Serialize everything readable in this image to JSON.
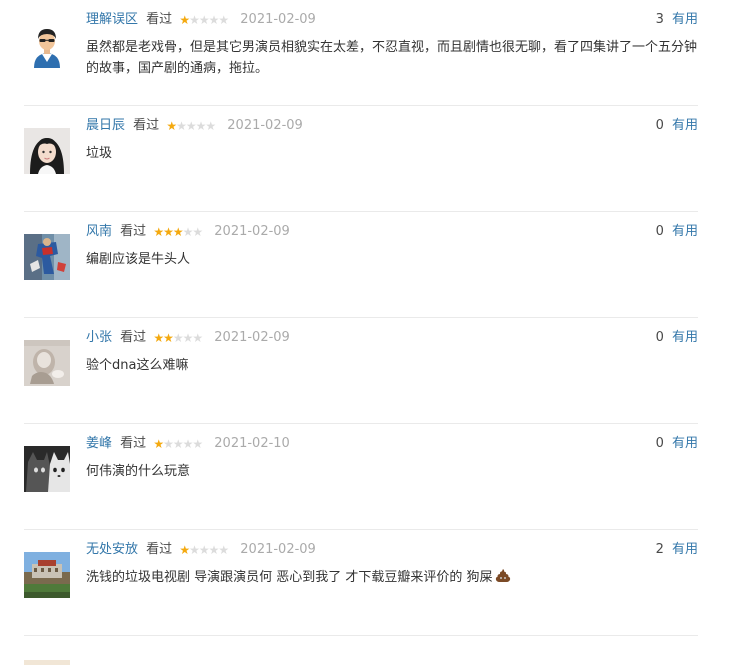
{
  "reviews": [
    {
      "user": "理解误区",
      "status": "看过",
      "stars": 1,
      "date": "2021-02-09",
      "votes": "3",
      "vote_label": "有用",
      "comment": "虽然都是老戏骨，但是其它男演员相貌实在太差，不忍直视，而且剧情也很无聊，看了四集讲了一个五分钟的故事，国产剧的通病，拖拉。"
    },
    {
      "user": "晨日辰",
      "status": "看过",
      "stars": 1,
      "date": "2021-02-09",
      "votes": "0",
      "vote_label": "有用",
      "comment": "垃圾"
    },
    {
      "user": "风南",
      "status": "看过",
      "stars": 3,
      "date": "2021-02-09",
      "votes": "0",
      "vote_label": "有用",
      "comment": "编剧应该是牛头人"
    },
    {
      "user": "小张",
      "status": "看过",
      "stars": 2,
      "date": "2021-02-09",
      "votes": "0",
      "vote_label": "有用",
      "comment": "验个dna这么难嘛"
    },
    {
      "user": "姜峰",
      "status": "看过",
      "stars": 1,
      "date": "2021-02-10",
      "votes": "0",
      "vote_label": "有用",
      "comment": "何伟演的什么玩意"
    },
    {
      "user": "无处安放",
      "status": "看过",
      "stars": 1,
      "date": "2021-02-09",
      "votes": "2",
      "vote_label": "有用",
      "comment": "洗钱的垃圾电视剧 导演跟演员何 恶心到我了 才下载豆瓣来评价的 狗屎"
    }
  ],
  "colors": {
    "link": "#3377aa",
    "star_on": "#f4a90f",
    "star_off": "#dcdcdc",
    "date": "#aaaaaa"
  }
}
